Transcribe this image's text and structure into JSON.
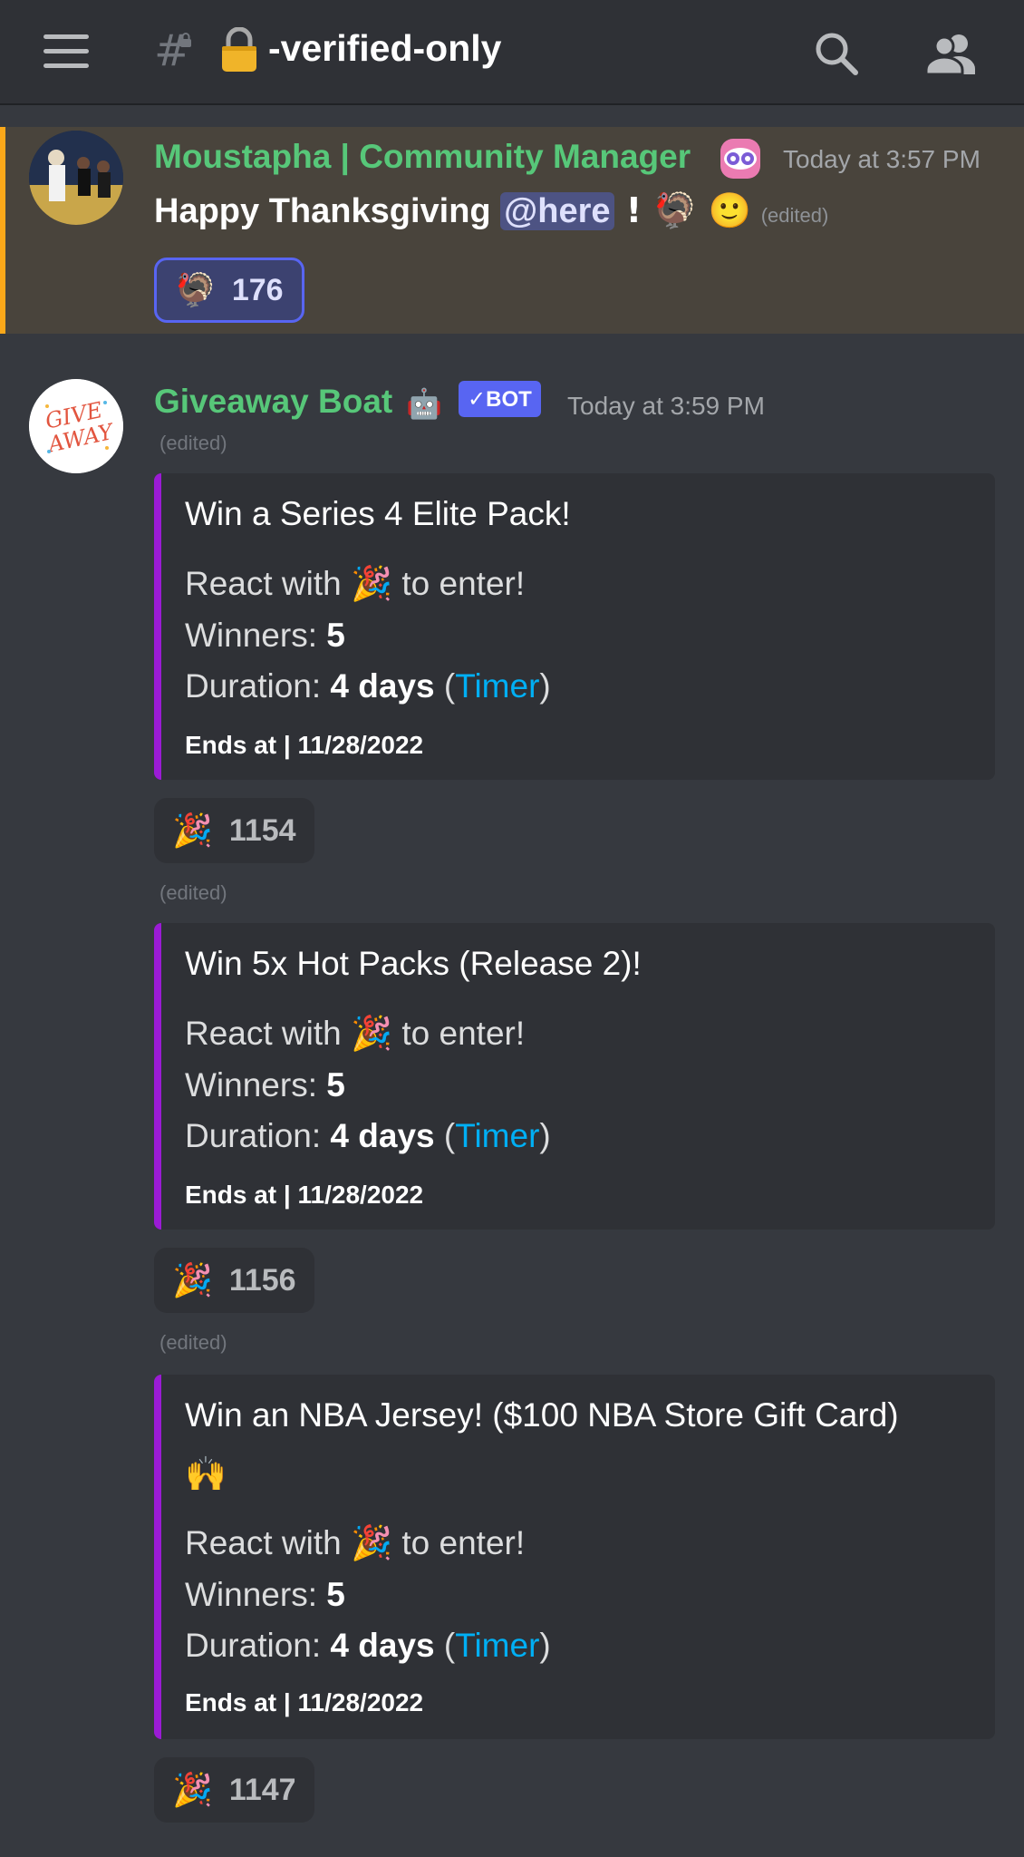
{
  "header": {
    "channel_prefix": "#",
    "channel_name": "-verified-only"
  },
  "messages": [
    {
      "author": "Moustapha | Community Manager",
      "timestamp": "Today at 3:57 PM",
      "text_before": "Happy Thanksgiving ",
      "mention": "@here",
      "text_after": " ! 🦃 🙂",
      "edited": "(edited)",
      "reaction": {
        "emoji": "🦃",
        "count": "176"
      }
    },
    {
      "author": "Giveaway Boat",
      "author_icon": "🤖",
      "badge": "✓BOT",
      "timestamp": "Today at 3:59 PM",
      "edited": "(edited)",
      "avatar_text": "GIVE AWAY"
    }
  ],
  "embeds": [
    {
      "title": "Win a Series 4 Elite Pack!",
      "react_label": "React with",
      "react_emoji": "🎉",
      "react_suffix": "to enter!",
      "winners_label": "Winners:",
      "winners": "5",
      "duration_label": "Duration:",
      "duration": "4 days",
      "timer_link": "Timer",
      "ends": "Ends at | 11/28/2022",
      "reaction": {
        "emoji": "🎉",
        "count": "1154"
      },
      "edited_after": "(edited)"
    },
    {
      "title": "Win 5x Hot Packs (Release 2)!",
      "react_label": "React with",
      "react_emoji": "🎉",
      "react_suffix": "to enter!",
      "winners_label": "Winners:",
      "winners": "5",
      "duration_label": "Duration:",
      "duration": "4 days",
      "timer_link": "Timer",
      "ends": "Ends at | 11/28/2022",
      "reaction": {
        "emoji": "🎉",
        "count": "1156"
      },
      "edited_after": "(edited)"
    },
    {
      "title": "Win an NBA Jersey! ($100 NBA Store Gift Card)",
      "title_emoji": "🙌",
      "react_label": "React with",
      "react_emoji": "🎉",
      "react_suffix": "to enter!",
      "winners_label": "Winners:",
      "winners": "5",
      "duration_label": "Duration:",
      "duration": "4 days",
      "timer_link": "Timer",
      "ends": "Ends at | 11/28/2022",
      "reaction": {
        "emoji": "🎉",
        "count": "1147"
      }
    }
  ],
  "colors": {
    "background": "#36393f",
    "header": "#2f3136",
    "username_green": "#57c779",
    "highlight": "#49443c",
    "highlight_border": "#faa81a",
    "embed_border": "#9b1bd5",
    "link": "#00aff4",
    "bot_badge": "#5865f2"
  }
}
